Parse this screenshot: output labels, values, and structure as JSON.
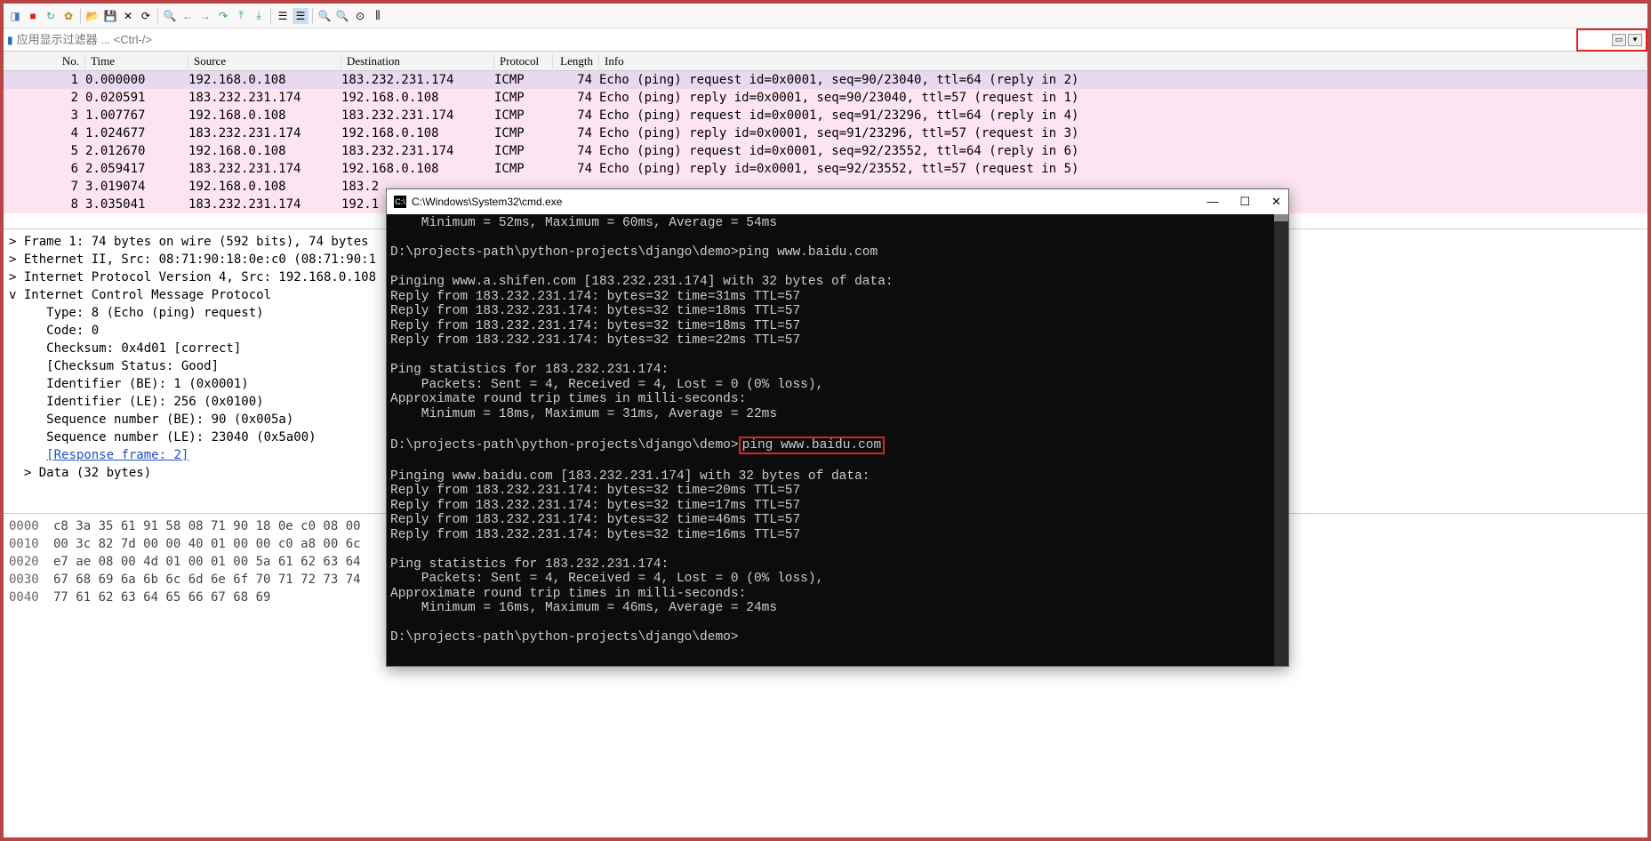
{
  "toolbar": {
    "icons": [
      "file",
      "stop",
      "restart",
      "settings",
      "|",
      "open",
      "save",
      "close",
      "reload",
      "|",
      "find",
      "back",
      "fwd",
      "jump",
      "first",
      "last",
      "|",
      "autoscroll",
      "colorize",
      "|",
      "zoom-in",
      "zoom-out",
      "zoom-reset",
      "resize-cols"
    ]
  },
  "filter": {
    "placeholder": "应用显示过滤器 ... <Ctrl-/>"
  },
  "columns": {
    "no": "No.",
    "time": "Time",
    "src": "Source",
    "dst": "Destination",
    "proto": "Protocol",
    "len": "Length",
    "info": "Info"
  },
  "packets": [
    {
      "no": "1",
      "time": "0.000000",
      "src": "192.168.0.108",
      "dst": "183.232.231.174",
      "proto": "ICMP",
      "len": "74",
      "info": "Echo (ping) request  id=0x0001, seq=90/23040, ttl=64 (reply in 2)",
      "cls": "sel"
    },
    {
      "no": "2",
      "time": "0.020591",
      "src": "183.232.231.174",
      "dst": "192.168.0.108",
      "proto": "ICMP",
      "len": "74",
      "info": "Echo (ping) reply    id=0x0001, seq=90/23040, ttl=57 (request in 1)",
      "cls": "pink"
    },
    {
      "no": "3",
      "time": "1.007767",
      "src": "192.168.0.108",
      "dst": "183.232.231.174",
      "proto": "ICMP",
      "len": "74",
      "info": "Echo (ping) request  id=0x0001, seq=91/23296, ttl=64 (reply in 4)",
      "cls": "pink"
    },
    {
      "no": "4",
      "time": "1.024677",
      "src": "183.232.231.174",
      "dst": "192.168.0.108",
      "proto": "ICMP",
      "len": "74",
      "info": "Echo (ping) reply    id=0x0001, seq=91/23296, ttl=57 (request in 3)",
      "cls": "pink"
    },
    {
      "no": "5",
      "time": "2.012670",
      "src": "192.168.0.108",
      "dst": "183.232.231.174",
      "proto": "ICMP",
      "len": "74",
      "info": "Echo (ping) request  id=0x0001, seq=92/23552, ttl=64 (reply in 6)",
      "cls": "pink"
    },
    {
      "no": "6",
      "time": "2.059417",
      "src": "183.232.231.174",
      "dst": "192.168.0.108",
      "proto": "ICMP",
      "len": "74",
      "info": "Echo (ping) reply    id=0x0001, seq=92/23552, ttl=57 (request in 5)",
      "cls": "pink"
    },
    {
      "no": "7",
      "time": "3.019074",
      "src": "192.168.0.108",
      "dst": "183.2",
      "proto": "",
      "len": "",
      "info": "",
      "cls": "pink"
    },
    {
      "no": "8",
      "time": "3.035041",
      "src": "183.232.231.174",
      "dst": "192.1",
      "proto": "",
      "len": "",
      "info": "",
      "cls": "pink"
    }
  ],
  "details": [
    "> Frame 1: 74 bytes on wire (592 bits), 74 bytes",
    "> Ethernet II, Src: 08:71:90:18:0e:c0 (08:71:90:1",
    "> Internet Protocol Version 4, Src: 192.168.0.108",
    "v Internet Control Message Protocol",
    "     Type: 8 (Echo (ping) request)",
    "     Code: 0",
    "     Checksum: 0x4d01 [correct]",
    "     [Checksum Status: Good]",
    "     Identifier (BE): 1 (0x0001)",
    "     Identifier (LE): 256 (0x0100)",
    "     Sequence number (BE): 90 (0x005a)",
    "     Sequence number (LE): 23040 (0x5a00)",
    "     [Response frame: 2]",
    "  > Data (32 bytes)"
  ],
  "details_link_index": 12,
  "hex": [
    {
      "off": "0000",
      "b": "c8 3a 35 61 91 58 08 71  90 18 0e c0 08 00"
    },
    {
      "off": "0010",
      "b": "00 3c 82 7d 00 00 40 01  00 00 c0 a8 00 6c"
    },
    {
      "off": "0020",
      "b": "e7 ae 08 00 4d 01 00 01  00 5a 61 62 63 64"
    },
    {
      "off": "0030",
      "b": "67 68 69 6a 6b 6c 6d 6e  6f 70 71 72 73 74"
    },
    {
      "off": "0040",
      "b": "77 61 62 63 64 65 66 67  68 69"
    }
  ],
  "cmd": {
    "title": "C:\\Windows\\System32\\cmd.exe",
    "lines": [
      "    Minimum = 52ms, Maximum = 60ms, Average = 54ms",
      "",
      "D:\\projects-path\\python-projects\\django\\demo>ping www.baidu.com",
      "",
      "Pinging www.a.shifen.com [183.232.231.174] with 32 bytes of data:",
      "Reply from 183.232.231.174: bytes=32 time=31ms TTL=57",
      "Reply from 183.232.231.174: bytes=32 time=18ms TTL=57",
      "Reply from 183.232.231.174: bytes=32 time=18ms TTL=57",
      "Reply from 183.232.231.174: bytes=32 time=22ms TTL=57",
      "",
      "Ping statistics for 183.232.231.174:",
      "    Packets: Sent = 4, Received = 4, Lost = 0 (0% loss),",
      "Approximate round trip times in milli-seconds:",
      "    Minimum = 18ms, Maximum = 31ms, Average = 22ms",
      "",
      "",
      "",
      "Pinging www.baidu.com [183.232.231.174] with 32 bytes of data:",
      "Reply from 183.232.231.174: bytes=32 time=20ms TTL=57",
      "Reply from 183.232.231.174: bytes=32 time=17ms TTL=57",
      "Reply from 183.232.231.174: bytes=32 time=46ms TTL=57",
      "Reply from 183.232.231.174: bytes=32 time=16ms TTL=57",
      "",
      "Ping statistics for 183.232.231.174:",
      "    Packets: Sent = 4, Received = 4, Lost = 0 (0% loss),",
      "Approximate round trip times in milli-seconds:",
      "    Minimum = 16ms, Maximum = 46ms, Average = 24ms",
      "",
      "D:\\projects-path\\python-projects\\django\\demo>"
    ],
    "highlight_prompt": "D:\\projects-path\\python-projects\\django\\demo>",
    "highlight_cmd": "ping www.baidu.com"
  }
}
